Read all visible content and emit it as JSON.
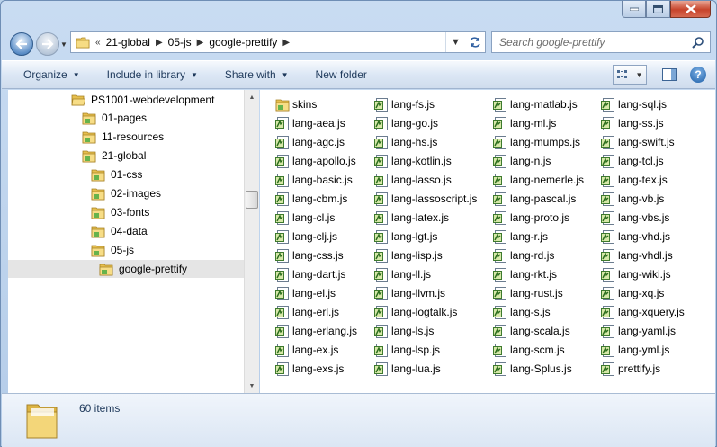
{
  "address": {
    "crumbs": [
      "21-global",
      "05-js",
      "google-prettify"
    ],
    "overflow": "«"
  },
  "search": {
    "placeholder": "Search google-prettify"
  },
  "toolbar": {
    "organize": "Organize",
    "include_in_library": "Include in library",
    "share_with": "Share with",
    "new_folder": "New folder",
    "help": "?"
  },
  "nav": {
    "items": [
      {
        "label": "PS1001-webdevelopment",
        "display": "PS1001-webdevelopment"
      },
      {
        "label": "01-pages"
      },
      {
        "label": "11-resources"
      },
      {
        "label": "21-global"
      },
      {
        "label": "01-css"
      },
      {
        "label": "02-images"
      },
      {
        "label": "03-fonts"
      },
      {
        "label": "04-data"
      },
      {
        "label": "05-js"
      },
      {
        "label": "google-prettify",
        "selected": true
      }
    ]
  },
  "files": {
    "col1": [
      "skins",
      "lang-aea.js",
      "lang-agc.js",
      "lang-apollo.js",
      "lang-basic.js",
      "lang-cbm.js",
      "lang-cl.js",
      "lang-clj.js",
      "lang-css.js",
      "lang-dart.js",
      "lang-el.js",
      "lang-erl.js",
      "lang-erlang.js",
      "lang-ex.js",
      "lang-exs.js"
    ],
    "col2": [
      "lang-fs.js",
      "lang-go.js",
      "lang-hs.js",
      "lang-kotlin.js",
      "lang-lasso.js",
      "lang-lassoscript.js",
      "lang-latex.js",
      "lang-lgt.js",
      "lang-lisp.js",
      "lang-ll.js",
      "lang-llvm.js",
      "lang-logtalk.js",
      "lang-ls.js",
      "lang-lsp.js",
      "lang-lua.js"
    ],
    "col3": [
      "lang-matlab.js",
      "lang-ml.js",
      "lang-mumps.js",
      "lang-n.js",
      "lang-nemerle.js",
      "lang-pascal.js",
      "lang-proto.js",
      "lang-r.js",
      "lang-rd.js",
      "lang-rkt.js",
      "lang-rust.js",
      "lang-s.js",
      "lang-scala.js",
      "lang-scm.js",
      "lang-Splus.js"
    ],
    "col4": [
      "lang-sql.js",
      "lang-ss.js",
      "lang-swift.js",
      "lang-tcl.js",
      "lang-tex.js",
      "lang-vb.js",
      "lang-vbs.js",
      "lang-vhd.js",
      "lang-vhdl.js",
      "lang-wiki.js",
      "lang-xq.js",
      "lang-xquery.js",
      "lang-yaml.js",
      "lang-yml.js",
      "prettify.js"
    ]
  },
  "status": {
    "item_count": "60 items"
  }
}
